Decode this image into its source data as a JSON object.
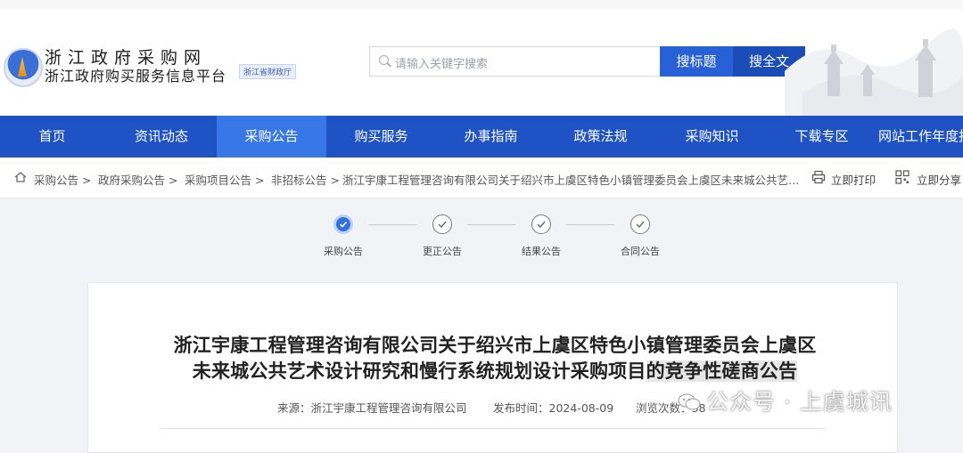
{
  "top_strip": {
    "left": "",
    "right": ""
  },
  "header": {
    "site_name": "浙江政府采购网",
    "site_subtitle": "浙江政府购买服务信息平台",
    "org_badge": "浙江省财政厅",
    "search": {
      "placeholder": "请输入关键字搜索",
      "btn_title": "搜标题",
      "btn_full": "搜全文"
    }
  },
  "nav": {
    "items": [
      "首页",
      "资讯动态",
      "采购公告",
      "购买服务",
      "办事指南",
      "政策法规",
      "采购知识",
      "下载专区",
      "网站工作年度报"
    ],
    "active_index": 2
  },
  "breadcrumb": {
    "items": [
      "采购公告 >",
      "政府采购公告 >",
      "采购项目公告 >",
      "非招标公告 >"
    ],
    "current": "浙江宇康工程管理咨询有限公司关于绍兴市上虞区特色小镇管理委员会上虞区未来城公共艺术设计研究和慢行系统规划设计采购项目的竞争性磋商公告",
    "print_label": "立即打印",
    "share_label": "立即分享"
  },
  "steps": [
    {
      "label": "采购公告",
      "done": true
    },
    {
      "label": "更正公告",
      "done": false
    },
    {
      "label": "结果公告",
      "done": false
    },
    {
      "label": "合同公告",
      "done": false
    }
  ],
  "article": {
    "title_main": "浙江宇康工程管理咨询有限公司关于绍兴市上虞区特色小镇管理委员会上虞区未来城公共艺术设计研究和慢行系统规划设计采购项目",
    "title_highlight": "的竞争性磋商公告",
    "source": "来源：浙江宇康工程管理咨询有限公司",
    "publish_time": "发布时间：2024-08-09",
    "views": "浏览次数：38"
  },
  "watermark": "公众号 · 上虞城讯"
}
